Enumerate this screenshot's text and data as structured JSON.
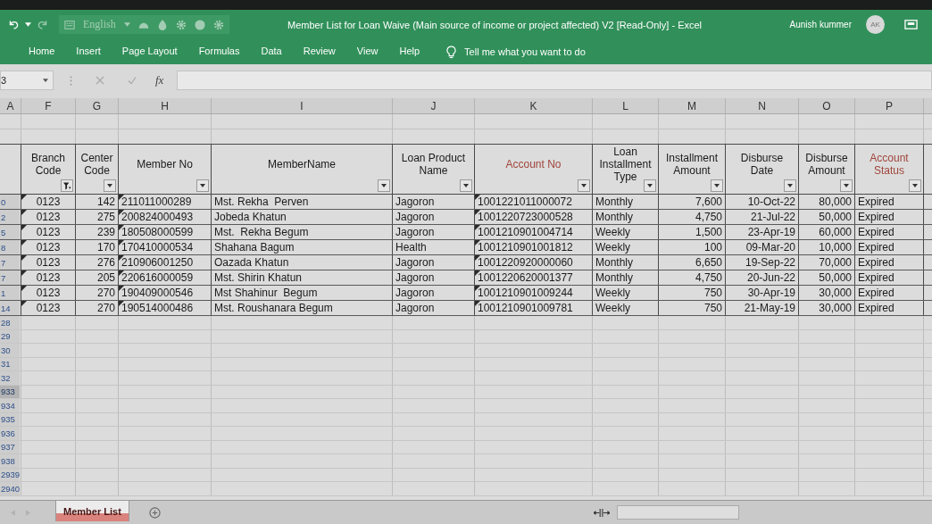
{
  "title_bar": {
    "language": "English",
    "title": "Member List for Loan Waive (Main source of income or project affected) V2 [Read-Only] - Excel",
    "user": "Aunish kummer",
    "avatar": "AK"
  },
  "ribbon_tabs": [
    {
      "label": "Home",
      "selected": false
    },
    {
      "label": "Insert",
      "selected": false
    },
    {
      "label": "Page Layout",
      "selected": false
    },
    {
      "label": "Formulas",
      "selected": false
    },
    {
      "label": "Data",
      "selected": false
    },
    {
      "label": "Review",
      "selected": false
    },
    {
      "label": "View",
      "selected": false
    },
    {
      "label": "Help",
      "selected": false
    }
  ],
  "tell_me": {
    "placeholder": "Tell me what you want to do"
  },
  "formula_bar": {
    "name_box": "3",
    "function_label": "fx"
  },
  "column_letters": [
    "A",
    "F",
    "G",
    "H",
    "I",
    "J",
    "K",
    "L",
    "M",
    "N",
    "O",
    "P"
  ],
  "table": {
    "columns": [
      {
        "label": "Branch Code",
        "kind": "code",
        "filtered": true,
        "color": "#1a1a1a"
      },
      {
        "label": "Center Code",
        "kind": "number",
        "filtered": false,
        "color": "#1a1a1a"
      },
      {
        "label": "Member No",
        "kind": "id",
        "filtered": false,
        "color": "#1a1a1a"
      },
      {
        "label": "MemberName",
        "kind": "text",
        "filtered": false,
        "color": "#1a1a1a"
      },
      {
        "label": "Loan Product Name",
        "kind": "text",
        "filtered": false,
        "color": "#1a1a1a"
      },
      {
        "label": "Account No",
        "kind": "id",
        "filtered": false,
        "color": "#a0463c"
      },
      {
        "label": "Loan Installment Type",
        "kind": "text",
        "filtered": false,
        "color": "#1a1a1a"
      },
      {
        "label": "Installment Amount",
        "kind": "number",
        "filtered": false,
        "color": "#1a1a1a"
      },
      {
        "label": "Disburse Date",
        "kind": "date",
        "filtered": false,
        "color": "#1a1a1a"
      },
      {
        "label": "Disburse Amount",
        "kind": "number",
        "filtered": false,
        "color": "#1a1a1a"
      },
      {
        "label": "Account Status",
        "kind": "text",
        "filtered": false,
        "color": "#a0463c"
      }
    ],
    "rows": [
      {
        "row_number": "0",
        "selected": false,
        "cells": [
          "0123",
          "142",
          "211011000289",
          "Mst. Rekha  Perven",
          "Jagoron",
          "1001221011000072",
          "Monthly",
          "7,600",
          "10-Oct-22",
          "80,000",
          "Expired"
        ]
      },
      {
        "row_number": "2",
        "selected": false,
        "cells": [
          "0123",
          "275",
          "200824000493",
          "Jobeda Khatun",
          "Jagoron",
          "1001220723000528",
          "Monthly",
          "4,750",
          "21-Jul-22",
          "50,000",
          "Expired"
        ]
      },
      {
        "row_number": "5",
        "selected": false,
        "cells": [
          "0123",
          "239",
          "180508000599",
          "Mst.  Rekha Begum",
          "Jagoron",
          "1001210901004714",
          "Weekly",
          "1,500",
          "23-Apr-19",
          "60,000",
          "Expired"
        ]
      },
      {
        "row_number": "8",
        "selected": false,
        "cells": [
          "0123",
          "170",
          "170410000534",
          "Shahana Bagum",
          "Health",
          "1001210901001812",
          "Weekly",
          "100",
          "09-Mar-20",
          "10,000",
          "Expired"
        ]
      },
      {
        "row_number": "7",
        "selected": false,
        "cells": [
          "0123",
          "276",
          "210906001250",
          "Oazada Khatun",
          "Jagoron",
          "1001220920000060",
          "Monthly",
          "6,650",
          "19-Sep-22",
          "70,000",
          "Expired"
        ]
      },
      {
        "row_number": "7",
        "selected": false,
        "cells": [
          "0123",
          "205",
          "220616000059",
          "Mst. Shirin Khatun",
          "Jagoron",
          "1001220620001377",
          "Monthly",
          "4,750",
          "20-Jun-22",
          "50,000",
          "Expired"
        ]
      },
      {
        "row_number": "1",
        "selected": false,
        "cells": [
          "0123",
          "270",
          "190409000546",
          "Mst Shahinur  Begum",
          "Jagoron",
          "1001210901009244",
          "Weekly",
          "750",
          "30-Apr-19",
          "30,000",
          "Expired"
        ]
      },
      {
        "row_number": "14",
        "selected": false,
        "cells": [
          "0123",
          "270",
          "190514000486",
          "Mst. Roushanara Begum",
          "Jagoron",
          "1001210901009781",
          "Weekly",
          "750",
          "21-May-19",
          "30,000",
          "Expired"
        ]
      }
    ]
  },
  "empty_rows": [
    {
      "row_number": "28",
      "selected": false
    },
    {
      "row_number": "29",
      "selected": false
    },
    {
      "row_number": "30",
      "selected": false
    },
    {
      "row_number": "31",
      "selected": false
    },
    {
      "row_number": "32",
      "selected": false
    },
    {
      "row_number": "933",
      "selected": true
    },
    {
      "row_number": "934",
      "selected": false
    },
    {
      "row_number": "935",
      "selected": false
    },
    {
      "row_number": "936",
      "selected": false
    },
    {
      "row_number": "937",
      "selected": false
    },
    {
      "row_number": "938",
      "selected": false
    },
    {
      "row_number": "2939",
      "selected": false
    },
    {
      "row_number": "2940",
      "selected": false
    }
  ],
  "sheet_tabs": [
    {
      "label": "Member List",
      "selected": true,
      "color": "#d9837c"
    }
  ]
}
